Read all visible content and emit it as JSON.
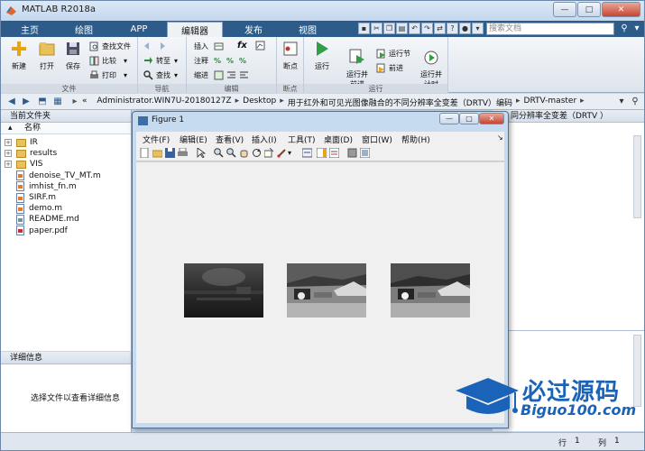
{
  "window": {
    "title": "MATLAB R2018a",
    "controls": [
      "—",
      "□",
      "✕"
    ]
  },
  "tabs": [
    {
      "label": "主页"
    },
    {
      "label": "绘图"
    },
    {
      "label": "APP"
    },
    {
      "label": "编辑器",
      "active": true
    },
    {
      "label": "发布"
    },
    {
      "label": "视图"
    }
  ],
  "search": {
    "placeholder": "搜索文档"
  },
  "ribbon": {
    "file_group": {
      "label": "文件",
      "new": "新建",
      "open": "打开",
      "save": "保存",
      "find_files": "查找文件",
      "compare": "比较",
      "print": "打印"
    },
    "nav_group": {
      "label": "导航",
      "goto": "转至",
      "find": "查找"
    },
    "edit_group": {
      "label": "编辑",
      "insert": "插入",
      "comment": "注释",
      "indent": "缩进",
      "fx": "fx"
    },
    "breakpoint_group": {
      "label": "断点",
      "breakpoints": "断点"
    },
    "run_group": {
      "label": "运行",
      "run": "运行",
      "run_advance": "运行并\n前进",
      "run_section": "运行节",
      "advance": "前进",
      "run_time": "运行并\n计时"
    }
  },
  "address": {
    "crumbs": [
      "«",
      "Administrator.WIN7U-20180127Z",
      "Desktop",
      "用于红外和可见光图像融合的不同分辨率全变差（DRTV）编码",
      "DRTV-master"
    ]
  },
  "current_folder": {
    "title": "当前文件夹",
    "column": "名称",
    "items": [
      {
        "name": "IR",
        "type": "folder"
      },
      {
        "name": "results",
        "type": "folder"
      },
      {
        "name": "VIS",
        "type": "folder"
      },
      {
        "name": "denoise_TV_MT.m",
        "type": "m"
      },
      {
        "name": "imhist_fn.m",
        "type": "m"
      },
      {
        "name": "SIRF.m",
        "type": "m"
      },
      {
        "name": "demo.m",
        "type": "m"
      },
      {
        "name": "README.md",
        "type": "md"
      },
      {
        "name": "paper.pdf",
        "type": "pdf"
      }
    ]
  },
  "details": {
    "title": "详细信息",
    "message": "选择文件以查看详细信息"
  },
  "right_panel": {
    "title": "同分辨率全变差（DRTV ）"
  },
  "status": {
    "row_label": "行",
    "row": "1",
    "col_label": "列",
    "col": "1"
  },
  "figure": {
    "title": "Figure 1",
    "menu": [
      "文件(F)",
      "编辑(E)",
      "查看(V)",
      "插入(I)",
      "工具(T)",
      "桌面(D)",
      "窗口(W)",
      "帮助(H)"
    ],
    "images": [
      "infrared-image",
      "visible-image",
      "fused-image"
    ]
  },
  "watermark": {
    "cn": "必过源码",
    "en": "Biguo100.com"
  },
  "colors": {
    "tab_bar": "#2d5c8a",
    "watermark": "#1a63b8"
  }
}
